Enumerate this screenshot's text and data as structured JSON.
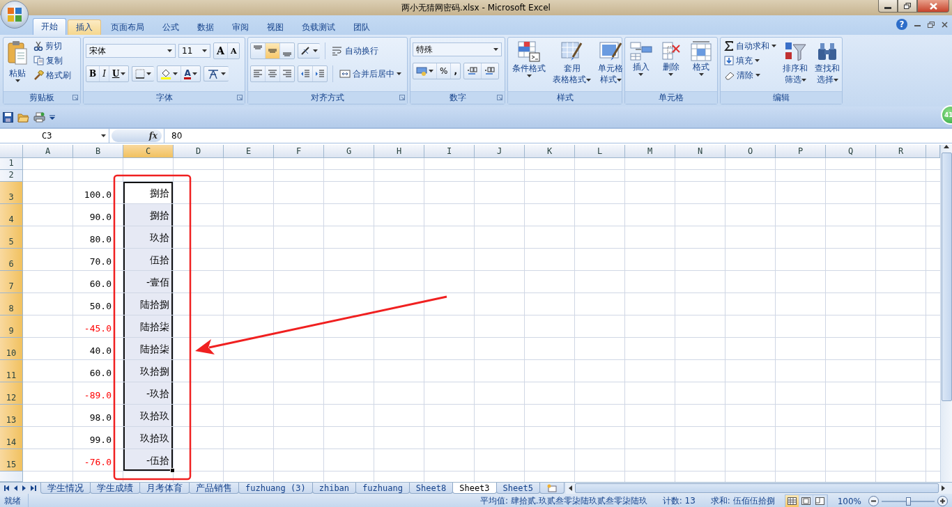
{
  "window": {
    "title": "两小无猜网密码.xlsx - Microsoft Excel"
  },
  "ribbon_tabs": [
    {
      "label": "开始",
      "selected": true,
      "hovered": false
    },
    {
      "label": "插入",
      "selected": false,
      "hovered": true
    },
    {
      "label": "页面布局",
      "selected": false,
      "hovered": false
    },
    {
      "label": "公式",
      "selected": false,
      "hovered": false
    },
    {
      "label": "数据",
      "selected": false,
      "hovered": false
    },
    {
      "label": "审阅",
      "selected": false,
      "hovered": false
    },
    {
      "label": "视图",
      "selected": false,
      "hovered": false
    },
    {
      "label": "负载测试",
      "selected": false,
      "hovered": false
    },
    {
      "label": "团队",
      "selected": false,
      "hovered": false
    }
  ],
  "ribbon_groups": [
    {
      "kind": "clipboard",
      "title": "剪贴板",
      "launcher": true,
      "paste": "粘贴",
      "small": [
        "剪切",
        "复制",
        "格式刷"
      ]
    },
    {
      "kind": "font",
      "title": "字体",
      "launcher": true,
      "font_name": "宋体",
      "font_size": "11",
      "grow": "A",
      "shrink": "A",
      "bold": "B",
      "italic": "I",
      "underline": "U",
      "font_color": "A"
    },
    {
      "kind": "alignment",
      "title": "对齐方式",
      "launcher": true,
      "vertical": [
        {
          "selected": false
        },
        {
          "selected": true
        },
        {
          "selected": false
        }
      ],
      "wrap": "自动换行",
      "merge": "合并后居中"
    },
    {
      "kind": "number",
      "title": "数字",
      "launcher": true,
      "format": "特殊",
      "percent": "%",
      "comma": ","
    },
    {
      "kind": "buttons",
      "title": "样式",
      "launcher": false,
      "items": [
        {
          "kind": "large",
          "lines": [
            "条件格式"
          ]
        },
        {
          "kind": "large",
          "lines": [
            "套用",
            "表格格式"
          ]
        },
        {
          "kind": "large",
          "lines": [
            "单元格",
            "样式"
          ]
        }
      ]
    },
    {
      "kind": "buttons",
      "title": "单元格",
      "launcher": false,
      "items": [
        {
          "kind": "large",
          "lines": [
            "插入"
          ]
        },
        {
          "kind": "large",
          "lines": [
            "删除"
          ]
        },
        {
          "kind": "large",
          "lines": [
            "格式"
          ]
        }
      ]
    },
    {
      "kind": "buttons",
      "title": "编辑",
      "launcher": false,
      "items": [
        {
          "kind": "stack",
          "labels": [
            "自动求和",
            "填充",
            "清除"
          ]
        },
        {
          "kind": "large",
          "lines": [
            "排序和",
            "筛选"
          ]
        },
        {
          "kind": "large",
          "lines": [
            "查找和",
            "选择"
          ]
        }
      ]
    }
  ],
  "ribbon_help": "?",
  "side_badge": "41",
  "formula_bar": {
    "name_box": "C3",
    "function_label": "fx",
    "value": "80"
  },
  "columns": [
    {
      "label": "A",
      "selected": false
    },
    {
      "label": "B",
      "selected": false
    },
    {
      "label": "C",
      "selected": true
    },
    {
      "label": "D",
      "selected": false
    },
    {
      "label": "E",
      "selected": false
    },
    {
      "label": "F",
      "selected": false
    },
    {
      "label": "G",
      "selected": false
    },
    {
      "label": "H",
      "selected": false
    },
    {
      "label": "I",
      "selected": false
    },
    {
      "label": "J",
      "selected": false
    },
    {
      "label": "K",
      "selected": false
    },
    {
      "label": "L",
      "selected": false
    },
    {
      "label": "M",
      "selected": false
    },
    {
      "label": "N",
      "selected": false
    },
    {
      "label": "O",
      "selected": false
    },
    {
      "label": "P",
      "selected": false
    },
    {
      "label": "Q",
      "selected": false
    },
    {
      "label": "R",
      "selected": false
    }
  ],
  "rows": [
    {
      "header": "1",
      "selected": false
    },
    {
      "header": "2",
      "selected": false
    },
    {
      "header": "3",
      "selected": true,
      "b": {
        "text": "100.0",
        "color": "#000000"
      },
      "c": {
        "text": "捌拾",
        "selected": true,
        "active": true
      }
    },
    {
      "header": "4",
      "selected": true,
      "b": {
        "text": "90.0",
        "color": "#000000"
      },
      "c": {
        "text": "捌拾",
        "selected": true,
        "active": false
      }
    },
    {
      "header": "5",
      "selected": true,
      "b": {
        "text": "80.0",
        "color": "#000000"
      },
      "c": {
        "text": "玖拾",
        "selected": true,
        "active": false
      }
    },
    {
      "header": "6",
      "selected": true,
      "b": {
        "text": "70.0",
        "color": "#000000"
      },
      "c": {
        "text": "伍拾",
        "selected": true,
        "active": false
      }
    },
    {
      "header": "7",
      "selected": true,
      "b": {
        "text": "60.0",
        "color": "#000000"
      },
      "c": {
        "text": "-壹佰",
        "selected": true,
        "active": false
      }
    },
    {
      "header": "8",
      "selected": true,
      "b": {
        "text": "50.0",
        "color": "#000000"
      },
      "c": {
        "text": "陆拾捌",
        "selected": true,
        "active": false
      }
    },
    {
      "header": "9",
      "selected": true,
      "b": {
        "text": "-45.0",
        "color": "#ff0000"
      },
      "c": {
        "text": "陆拾柒",
        "selected": true,
        "active": false
      }
    },
    {
      "header": "10",
      "selected": true,
      "b": {
        "text": "40.0",
        "color": "#000000"
      },
      "c": {
        "text": "陆拾柒",
        "selected": true,
        "active": false
      }
    },
    {
      "header": "11",
      "selected": true,
      "b": {
        "text": "60.0",
        "color": "#000000"
      },
      "c": {
        "text": "玖拾捌",
        "selected": true,
        "active": false
      }
    },
    {
      "header": "12",
      "selected": true,
      "b": {
        "text": "-89.0",
        "color": "#ff0000"
      },
      "c": {
        "text": "-玖拾",
        "selected": true,
        "active": false
      }
    },
    {
      "header": "13",
      "selected": true,
      "b": {
        "text": "98.0",
        "color": "#000000"
      },
      "c": {
        "text": "玖拾玖",
        "selected": true,
        "active": false
      }
    },
    {
      "header": "14",
      "selected": true,
      "b": {
        "text": "99.0",
        "color": "#000000"
      },
      "c": {
        "text": "玖拾玖",
        "selected": true,
        "active": false
      }
    },
    {
      "header": "15",
      "selected": true,
      "b": {
        "text": "-76.0",
        "color": "#ff0000"
      },
      "c": {
        "text": "-伍拾",
        "selected": true,
        "active": false
      }
    }
  ],
  "annotations": {
    "highlight_box": true,
    "arrow": true
  },
  "sheet_tabs": [
    {
      "label": "学生情况",
      "selected": false
    },
    {
      "label": "学生成绩",
      "selected": false
    },
    {
      "label": "月考体育",
      "selected": false
    },
    {
      "label": "产品销售",
      "selected": false
    },
    {
      "label": "fuzhuang (3)",
      "selected": false
    },
    {
      "label": "zhiban",
      "selected": false
    },
    {
      "label": "fuzhuang",
      "selected": false
    },
    {
      "label": "Sheet8",
      "selected": false
    },
    {
      "label": "Sheet3",
      "selected": true
    },
    {
      "label": "Sheet5",
      "selected": false
    }
  ],
  "status_bar": {
    "mode": "就绪",
    "average": "平均值: 肆拾贰.玖贰叁零柒陆玖贰叁零柒陆玖",
    "count": "计数: 13",
    "sum": "求和: 伍佰伍拾捌",
    "views": [
      {
        "selected": true
      },
      {
        "selected": false
      },
      {
        "selected": false
      }
    ],
    "zoom": "100%",
    "zoom_level": {
      "level": 0.5
    }
  }
}
